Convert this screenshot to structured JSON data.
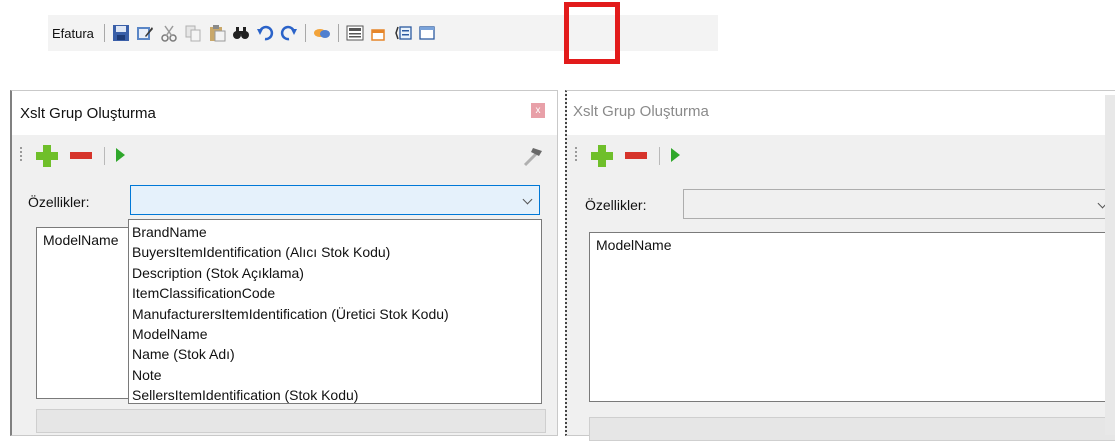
{
  "toolbar": {
    "label": "Efatura",
    "icons": [
      "save-icon",
      "edit-icon",
      "cut-icon",
      "copy-icon",
      "paste-icon",
      "find-icon",
      "undo-icon",
      "redo-icon",
      "link-icon",
      "form-icon",
      "small-window-icon",
      "list-properties-icon",
      "window-icon"
    ],
    "highlight_color": "#e21b1b"
  },
  "left_panel": {
    "title": "Xslt Grup Oluşturma",
    "close_label": "x",
    "properties_label": "Özellikler:",
    "list_items": [
      "ModelName"
    ]
  },
  "dropdown": {
    "options": [
      "BrandName",
      "BuyersItemIdentification (Alıcı Stok Kodu)",
      "Description (Stok Açıklama)",
      "ItemClassificationCode",
      "ManufacturersItemIdentification (Üretici Stok Kodu)",
      "ModelName",
      "Name (Stok Adı)",
      "Note",
      "SellersItemIdentification (Stok Kodu)"
    ]
  },
  "right_panel": {
    "title": "Xslt Grup Oluşturma",
    "properties_label": "Özellikler:",
    "list_items": [
      "ModelName"
    ]
  },
  "colors": {
    "add": "#6fbf2a",
    "remove": "#d6342b",
    "run": "#2fa72b",
    "combo_active_bg": "#e5f1fb",
    "combo_active_border": "#0078d7"
  }
}
